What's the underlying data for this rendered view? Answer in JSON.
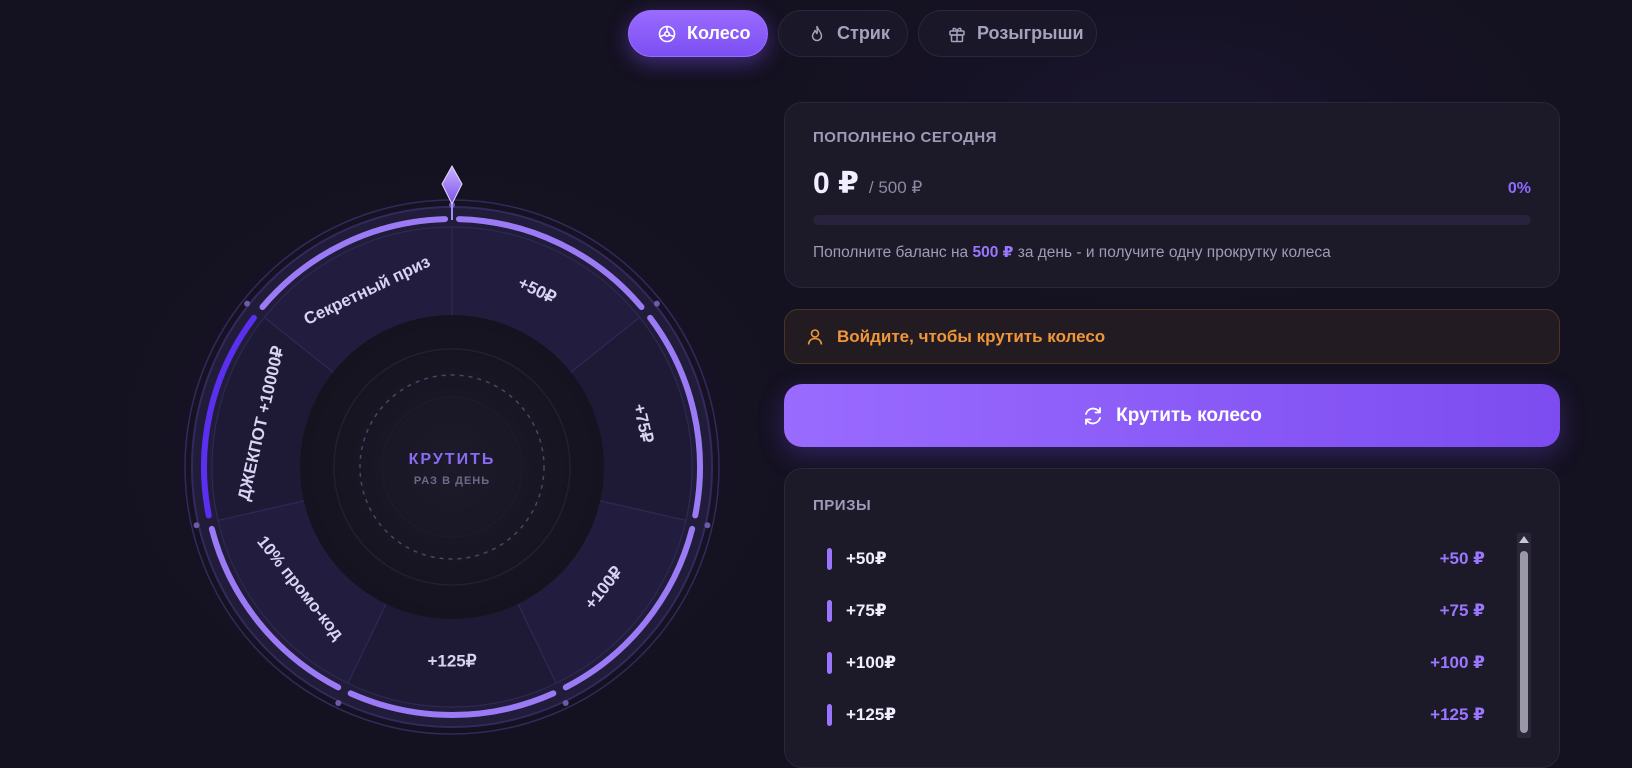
{
  "tabs": [
    {
      "label": "Колесо",
      "icon": "wheel-icon",
      "active": true
    },
    {
      "label": "Стрик",
      "icon": "flame-icon",
      "active": false
    },
    {
      "label": "Розыгрыши",
      "icon": "gift-icon",
      "active": false
    }
  ],
  "wheel": {
    "segments": [
      {
        "label": "+50₽"
      },
      {
        "label": "+75₽"
      },
      {
        "label": "+100₽"
      },
      {
        "label": "+125₽"
      },
      {
        "label": "10% промо-код"
      },
      {
        "label": "ДЖЕКПОТ +10000₽"
      },
      {
        "label": "Секретный приз"
      }
    ],
    "center_title": "КРУТИТЬ",
    "center_subtitle": "РАЗ В ДЕНЬ",
    "pointer_icon": "diamond-pointer-icon"
  },
  "today": {
    "title": "ПОПОЛНЕНО СЕГОДНЯ",
    "amount": "0 ₽",
    "goal": "/ 500 ₽",
    "percent_label": "0%",
    "progress": 0,
    "hint_prefix": "Пополните баланс на",
    "hint_amount": "500 ₽",
    "hint_suffix": "за день - и получите одну прокрутку колеса"
  },
  "login_alert": {
    "text": "Войдите, чтобы крутить колесо",
    "icon": "user-icon"
  },
  "spin_button": {
    "label": "Крутить колесо",
    "icon": "refresh-icon"
  },
  "prizes": {
    "title": "ПРИЗЫ",
    "items": [
      {
        "name": "+50₽",
        "value": "+50 ₽"
      },
      {
        "name": "+75₽",
        "value": "+75 ₽"
      },
      {
        "name": "+100₽",
        "value": "+100 ₽"
      },
      {
        "name": "+125₽",
        "value": "+125 ₽"
      }
    ]
  },
  "colors": {
    "accent": "#8f6bff",
    "background": "#141120",
    "panel": "#1c1929",
    "warning": "#f0963a"
  }
}
